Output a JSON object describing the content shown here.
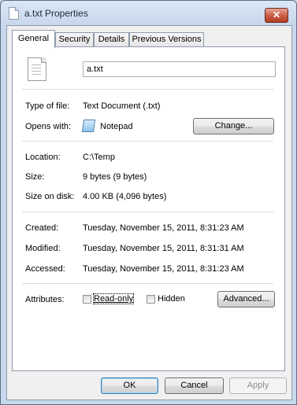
{
  "window": {
    "title": "a.txt Properties",
    "close_glyph": "✕"
  },
  "tabs": [
    {
      "label": "General"
    },
    {
      "label": "Security"
    },
    {
      "label": "Details"
    },
    {
      "label": "Previous Versions"
    }
  ],
  "general": {
    "file_name": "a.txt",
    "type_of_file": {
      "label": "Type of file:",
      "value": "Text Document (.txt)"
    },
    "opens_with": {
      "label": "Opens with:",
      "value": "Notepad",
      "change_button": "Change..."
    },
    "location": {
      "label": "Location:",
      "value": "C:\\Temp"
    },
    "size": {
      "label": "Size:",
      "value": "9 bytes (9 bytes)"
    },
    "size_on_disk": {
      "label": "Size on disk:",
      "value": "4.00 KB (4,096 bytes)"
    },
    "created": {
      "label": "Created:",
      "value": "Tuesday, November 15, 2011, 8:31:23 AM"
    },
    "modified": {
      "label": "Modified:",
      "value": "Tuesday, November 15, 2011, 8:31:31 AM"
    },
    "accessed": {
      "label": "Accessed:",
      "value": "Tuesday, November 15, 2011, 8:31:23 AM"
    },
    "attributes": {
      "label": "Attributes:",
      "read_only": {
        "label": "Read-only",
        "checked": false
      },
      "hidden": {
        "label": "Hidden",
        "checked": false
      },
      "advanced_button": "Advanced..."
    }
  },
  "buttons": {
    "ok": "OK",
    "cancel": "Cancel",
    "apply": "Apply"
  },
  "icons": {
    "title": "document-icon",
    "file": "text-document-icon",
    "opens_with": "notepad-icon"
  }
}
